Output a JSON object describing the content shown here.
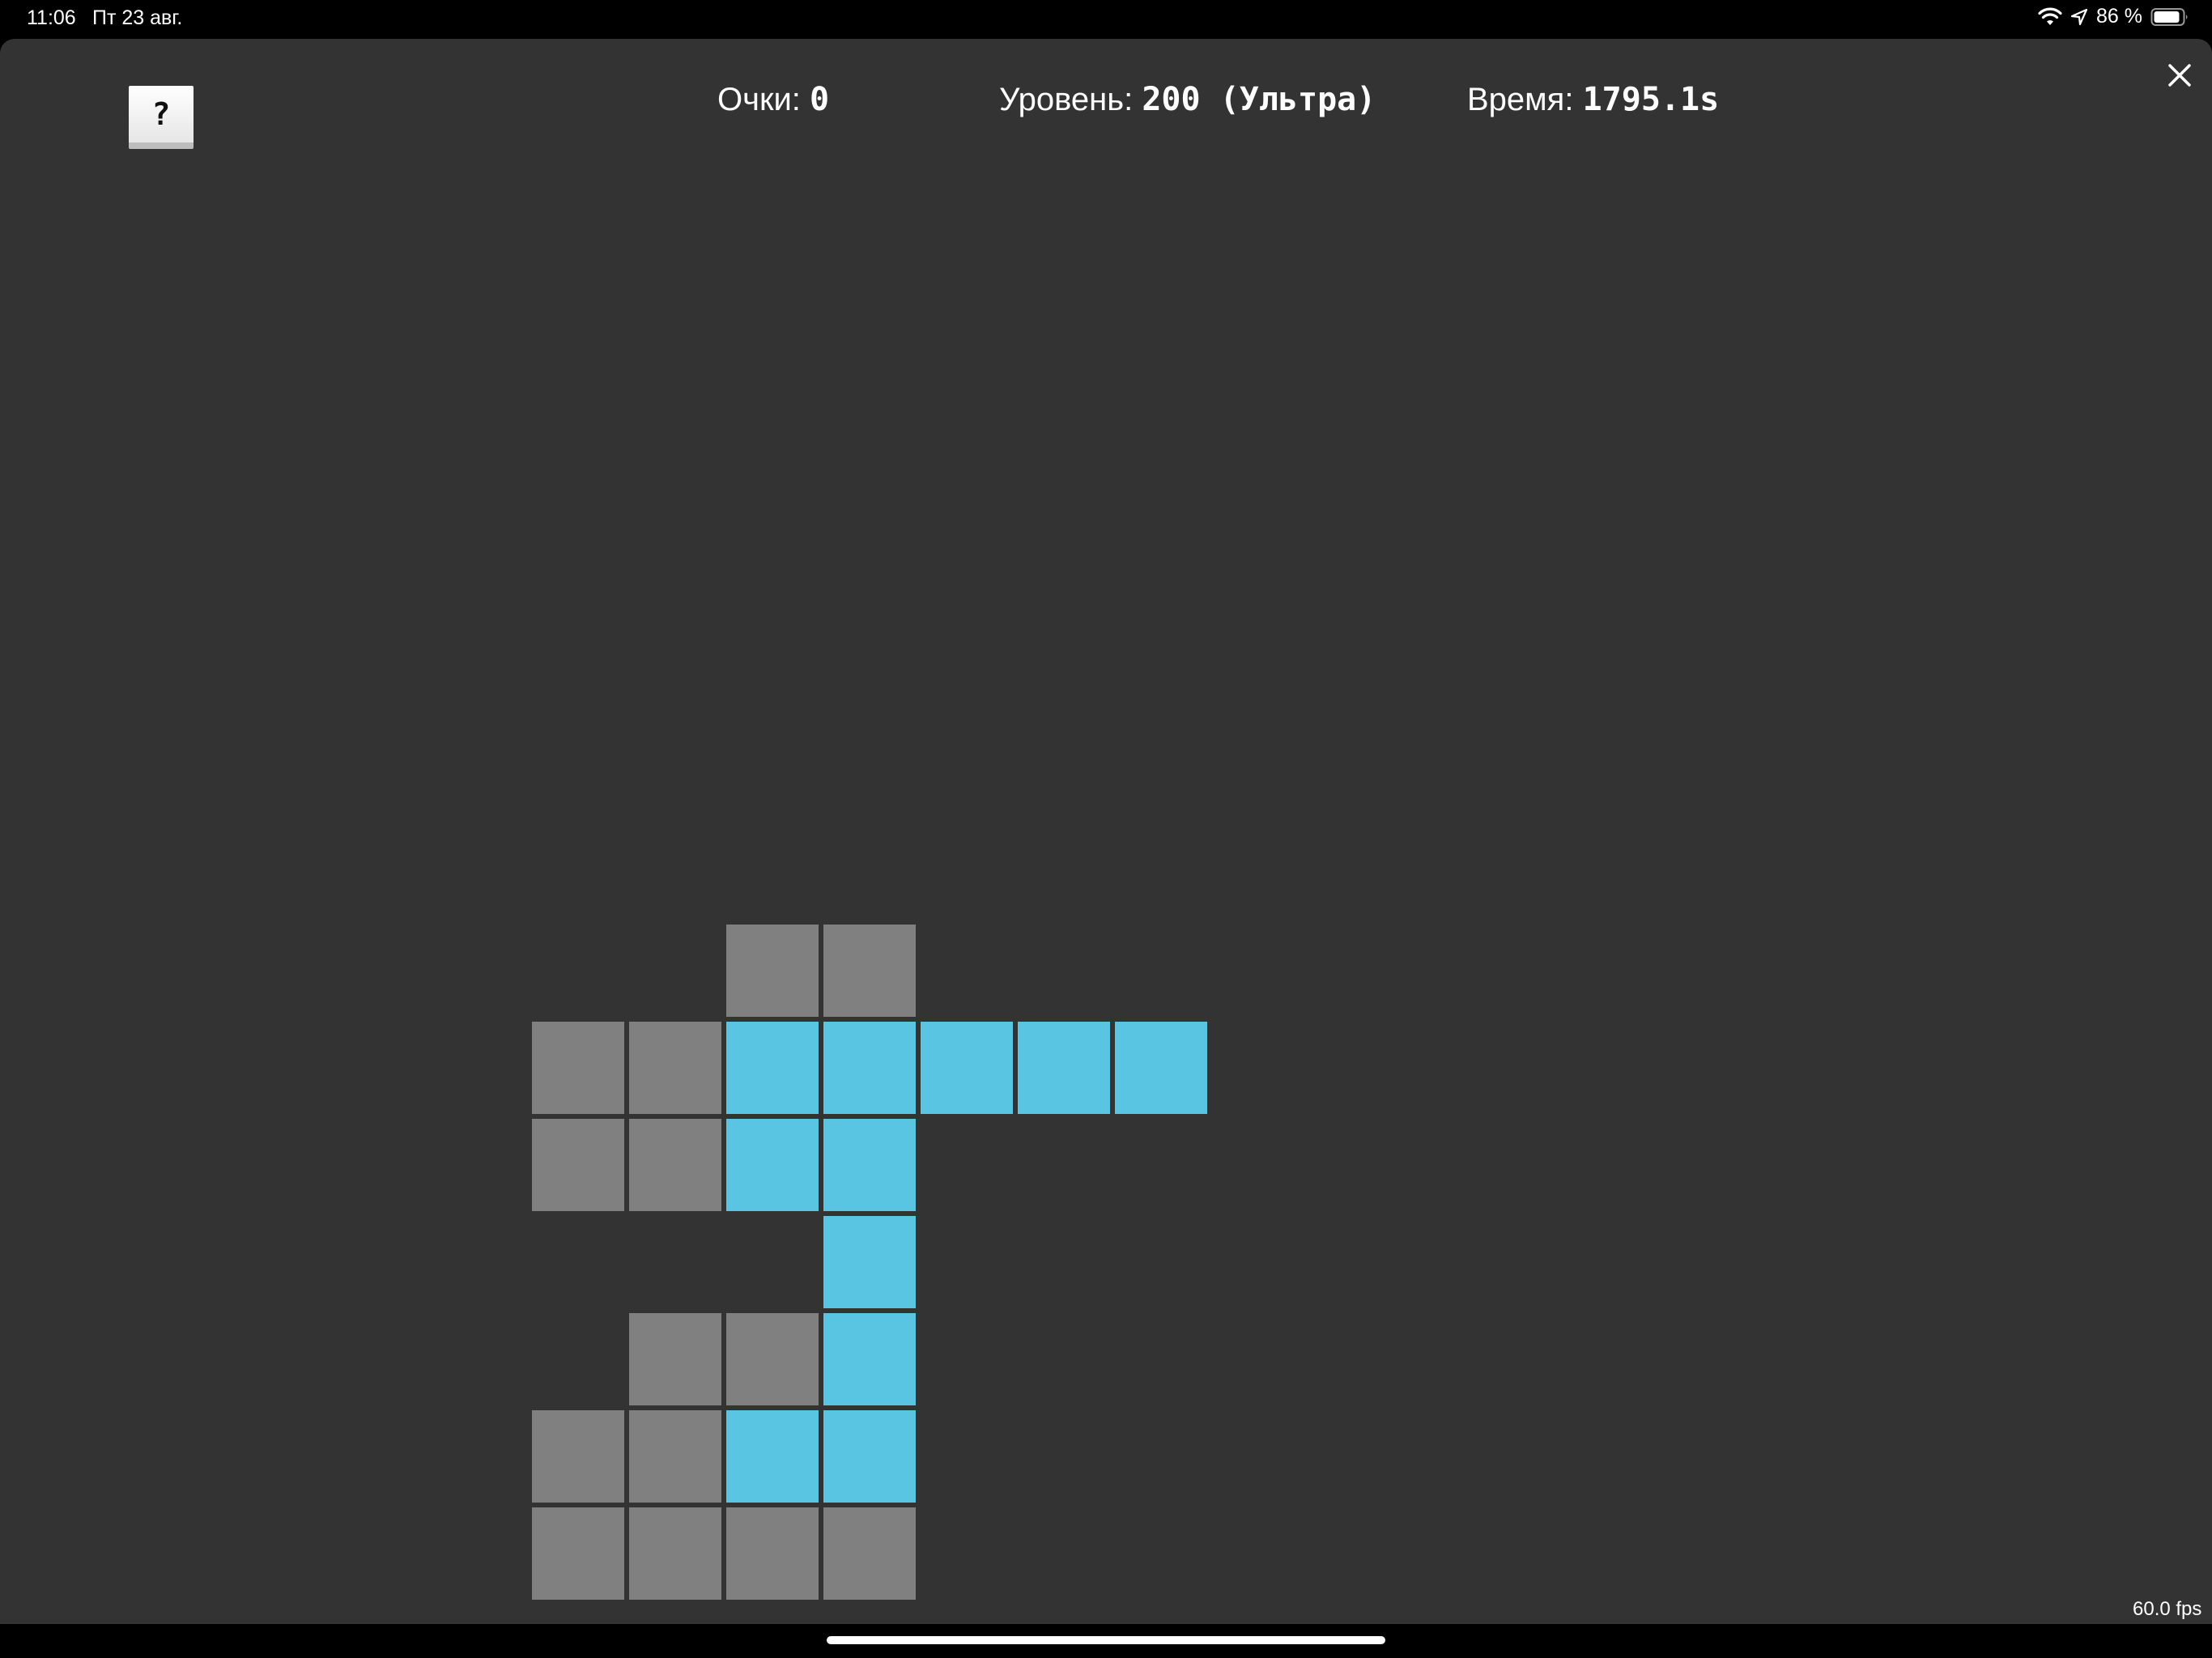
{
  "status_bar": {
    "time": "11:06",
    "date": "Пт 23 авг.",
    "battery_percent": "86 %",
    "icons": [
      "wifi-icon",
      "location-arrow-icon",
      "battery-icon"
    ]
  },
  "hud": {
    "score_label": "Очки:",
    "score_value": "0",
    "level_label": "Уровень:",
    "level_value": "200 (Ультра)",
    "time_label": "Время:",
    "time_value": "1795.1s"
  },
  "help_button": {
    "label": "?"
  },
  "close_button": {
    "icon": "close-icon"
  },
  "fps": "60.0 fps",
  "colors": {
    "background": "#333333",
    "block_grey": "#808080",
    "block_blue": "#5ac4e3"
  },
  "board": {
    "rows": [
      "..GG...",
      "GGBBBBB",
      "GGBB...",
      "...B...",
      ".GGB...",
      "GGBB...",
      "GGGG..."
    ]
  }
}
